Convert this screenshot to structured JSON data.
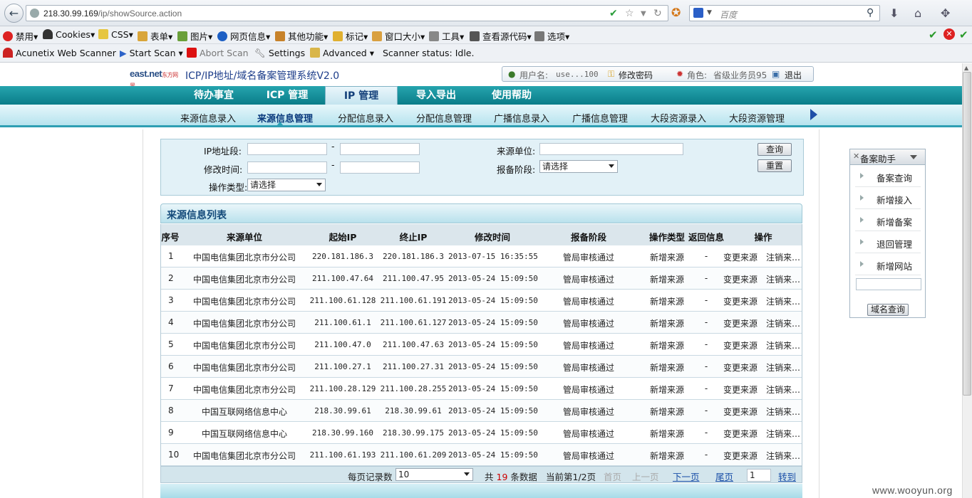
{
  "browser": {
    "url_host": "218.30.99.169",
    "url_path": "/ip/showSource.action",
    "search_placeholder": "百度",
    "toolbar1": [
      "禁用",
      "Cookies",
      "CSS",
      "表单",
      "图片",
      "网页信息",
      "其他功能",
      "标记",
      "窗口大小",
      "工具",
      "查看源代码",
      "选项"
    ],
    "toolbar2": {
      "scanner": "Acunetix Web Scanner",
      "start": "Start Scan",
      "abort": "Abort Scan",
      "settings": "Settings",
      "advanced": "Advanced",
      "status": "Scanner status: Idle."
    }
  },
  "app": {
    "logo": "east.net",
    "logo_sub": "东方网景",
    "title": "ICP/IP地址/域名备案管理系统V2.0",
    "user_label": "用户名:",
    "user_value": "use...100",
    "change_pwd": "修改密码",
    "role_label": "角色:",
    "role_value": "省级业务员95",
    "logout": "退出"
  },
  "main_nav": [
    "待办事宜",
    "ICP 管理",
    "IP 管理",
    "导入导出",
    "使用帮助"
  ],
  "sub_nav": [
    "来源信息录入",
    "来源信息管理",
    "分配信息录入",
    "分配信息管理",
    "广播信息录入",
    "广播信息管理",
    "大段资源录入",
    "大段资源管理"
  ],
  "filter": {
    "ip_label": "IP地址段:",
    "time_label": "修改时间:",
    "op_label": "操作类型:",
    "op_value": "请选择",
    "unit_label": "来源单位:",
    "stage_label": "报备阶段:",
    "stage_value": "请选择",
    "dash": "-",
    "query_btn": "查询",
    "reset_btn": "重置"
  },
  "list": {
    "title": "来源信息列表",
    "columns": [
      "序号",
      "来源单位",
      "起始IP",
      "终止IP",
      "修改时间",
      "报备阶段",
      "操作类型",
      "返回信息",
      "操作"
    ],
    "rows": [
      {
        "no": "1",
        "unit": "中国电信集团北京市分公司",
        "start": "220.181.186.3",
        "end": "220.181.186.3",
        "time": "2013-07-15 16:35:55",
        "stage": "管局审核通过",
        "type": "新增来源",
        "ret": "-",
        "a1": "变更来源",
        "a2": "注销来…"
      },
      {
        "no": "2",
        "unit": "中国电信集团北京市分公司",
        "start": "211.100.47.64",
        "end": "211.100.47.95",
        "time": "2013-05-24 15:09:50",
        "stage": "管局审核通过",
        "type": "新增来源",
        "ret": "-",
        "a1": "变更来源",
        "a2": "注销来…"
      },
      {
        "no": "3",
        "unit": "中国电信集团北京市分公司",
        "start": "211.100.61.128",
        "end": "211.100.61.191",
        "time": "2013-05-24 15:09:50",
        "stage": "管局审核通过",
        "type": "新增来源",
        "ret": "-",
        "a1": "变更来源",
        "a2": "注销来…"
      },
      {
        "no": "4",
        "unit": "中国电信集团北京市分公司",
        "start": "211.100.61.1",
        "end": "211.100.61.127",
        "time": "2013-05-24 15:09:50",
        "stage": "管局审核通过",
        "type": "新增来源",
        "ret": "-",
        "a1": "变更来源",
        "a2": "注销来…"
      },
      {
        "no": "5",
        "unit": "中国电信集团北京市分公司",
        "start": "211.100.47.0",
        "end": "211.100.47.63",
        "time": "2013-05-24 15:09:50",
        "stage": "管局审核通过",
        "type": "新增来源",
        "ret": "-",
        "a1": "变更来源",
        "a2": "注销来…"
      },
      {
        "no": "6",
        "unit": "中国电信集团北京市分公司",
        "start": "211.100.27.1",
        "end": "211.100.27.31",
        "time": "2013-05-24 15:09:50",
        "stage": "管局审核通过",
        "type": "新增来源",
        "ret": "-",
        "a1": "变更来源",
        "a2": "注销来…"
      },
      {
        "no": "7",
        "unit": "中国电信集团北京市分公司",
        "start": "211.100.28.129",
        "end": "211.100.28.255",
        "time": "2013-05-24 15:09:50",
        "stage": "管局审核通过",
        "type": "新增来源",
        "ret": "-",
        "a1": "变更来源",
        "a2": "注销来…"
      },
      {
        "no": "8",
        "unit": "中国互联网络信息中心",
        "start": "218.30.99.61",
        "end": "218.30.99.61",
        "time": "2013-05-24 15:09:50",
        "stage": "管局审核通过",
        "type": "新增来源",
        "ret": "-",
        "a1": "变更来源",
        "a2": "注销来…"
      },
      {
        "no": "9",
        "unit": "中国互联网络信息中心",
        "start": "218.30.99.160",
        "end": "218.30.99.175",
        "time": "2013-05-24 15:09:50",
        "stage": "管局审核通过",
        "type": "新增来源",
        "ret": "-",
        "a1": "变更来源",
        "a2": "注销来…"
      },
      {
        "no": "10",
        "unit": "中国电信集团北京市分公司",
        "start": "211.100.61.193",
        "end": "211.100.61.209",
        "time": "2013-05-24 15:09:50",
        "stage": "管局审核通过",
        "type": "新增来源",
        "ret": "-",
        "a1": "变更来源",
        "a2": "注销来…"
      }
    ]
  },
  "pager": {
    "per_page_label": "每页记录数",
    "per_page_value": "10",
    "total_prefix": "共",
    "total": "19",
    "total_suffix": "条数据",
    "current": "当前第1/2页",
    "first": "首页",
    "prev": "上一页",
    "next": "下一页",
    "last": "尾页",
    "page_input": "1",
    "goto": "转到"
  },
  "helper": {
    "title": "备案助手",
    "items": [
      "备案查询",
      "新增接入",
      "新增备案",
      "退回管理",
      "新增网站"
    ],
    "domain_btn": "域名查询"
  },
  "watermark": "www.wooyun.org",
  "colors": {
    "nav_teal": "#0a7d89",
    "accent_red": "#cc0000",
    "link_blue": "#1a4fa8"
  }
}
